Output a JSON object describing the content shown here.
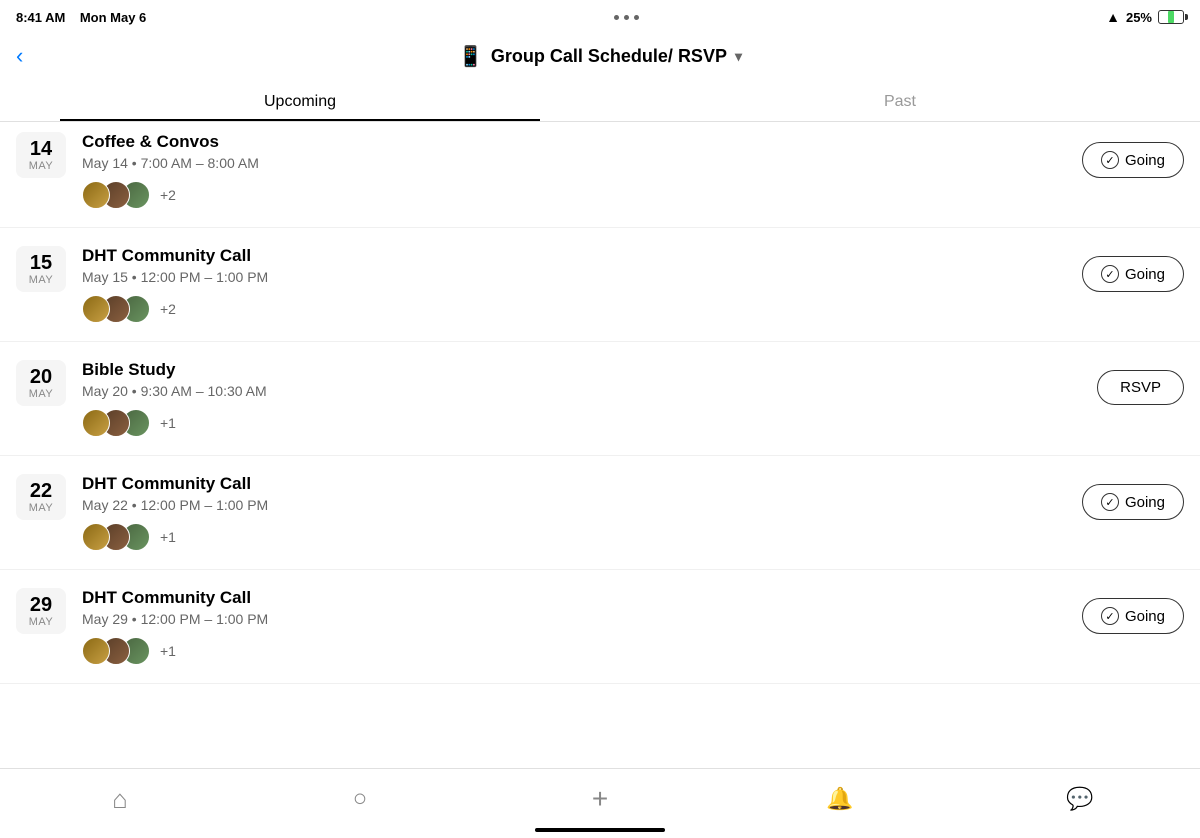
{
  "statusBar": {
    "time": "8:41 AM",
    "date": "Mon May 6",
    "wifi": "📶",
    "battery": "25%"
  },
  "header": {
    "title": "Group Call Schedule/ RSVP",
    "icon": "📱",
    "backLabel": "‹"
  },
  "tabs": [
    {
      "label": "Upcoming",
      "active": true
    },
    {
      "label": "Past",
      "active": false
    }
  ],
  "events": [
    {
      "id": "coffee-convos",
      "day": "14",
      "month": "MAY",
      "title": "Coffee & Convos",
      "time": "May 14 • 7:00 AM – 8:00 AM",
      "attendeeCount": "+2",
      "action": "Going",
      "actionType": "going",
      "partial": true
    },
    {
      "id": "dht-15",
      "day": "15",
      "month": "MAY",
      "title": "DHT Community Call",
      "time": "May 15 • 12:00 PM – 1:00 PM",
      "attendeeCount": "+2",
      "action": "Going",
      "actionType": "going",
      "partial": false
    },
    {
      "id": "bible-study",
      "day": "20",
      "month": "MAY",
      "title": "Bible Study",
      "time": "May 20 • 9:30 AM – 10:30 AM",
      "attendeeCount": "+1",
      "action": "RSVP",
      "actionType": "rsvp",
      "partial": false
    },
    {
      "id": "dht-22",
      "day": "22",
      "month": "MAY",
      "title": "DHT Community Call",
      "time": "May 22 • 12:00 PM – 1:00 PM",
      "attendeeCount": "+1",
      "action": "Going",
      "actionType": "going",
      "partial": false
    },
    {
      "id": "dht-29",
      "day": "29",
      "month": "MAY",
      "title": "DHT Community Call",
      "time": "May 29 • 12:00 PM – 1:00 PM",
      "attendeeCount": "+1",
      "action": "Going",
      "actionType": "going",
      "partial": false
    }
  ],
  "bottomNav": [
    {
      "id": "home",
      "icon": "⌂",
      "label": "Home"
    },
    {
      "id": "search",
      "icon": "⌕",
      "label": "Search"
    },
    {
      "id": "add",
      "icon": "+",
      "label": "Add"
    },
    {
      "id": "notifications",
      "icon": "🔔",
      "label": "Notifications"
    },
    {
      "id": "messages",
      "icon": "💬",
      "label": "Messages"
    }
  ]
}
